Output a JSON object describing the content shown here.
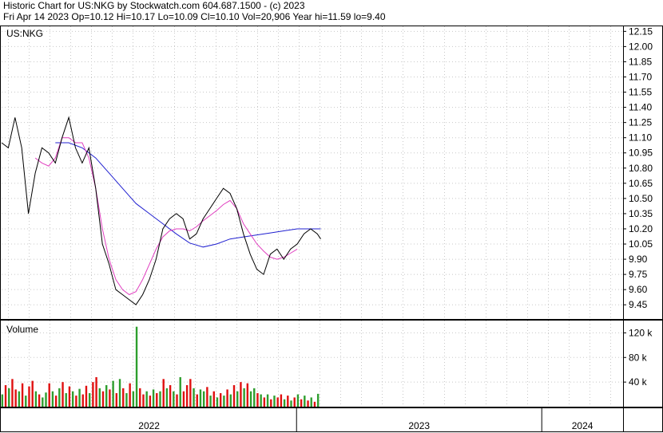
{
  "header": {
    "title": "Historic Chart for US:NKG by Stockwatch.com 604.687.1500 - (c) 2023",
    "quote": "Fri Apr 14 2023   Op=10.12  Hi=10.17  Lo=10.09  Cl=10.10  Vol=20,906  Year hi=11.59  lo=9.40"
  },
  "chart_data": {
    "type": "line",
    "symbol_label": "US:NKG",
    "volume_label": "Volume",
    "price_axis": {
      "ylim": [
        9.31,
        12.2
      ],
      "ticks": [
        "12.15",
        "12.00",
        "11.85",
        "11.70",
        "11.55",
        "11.40",
        "11.25",
        "11.10",
        "10.95",
        "10.80",
        "10.65",
        "10.50",
        "10.35",
        "10.20",
        "10.05",
        "9.90",
        "9.75",
        "9.60",
        "9.45"
      ]
    },
    "volume_axis": {
      "ylim": [
        0,
        140000
      ],
      "ticks": [
        {
          "label": "120 k",
          "value": 120000
        },
        {
          "label": "80 k",
          "value": 80000
        },
        {
          "label": "40 k",
          "value": 40000
        }
      ]
    },
    "x_axis": {
      "labels": [
        "2022",
        "2023",
        "2024"
      ],
      "year_boundaries": [
        "2023-01-01",
        "2024-01-01"
      ],
      "range": [
        "2021-10-19",
        "2024-05-01"
      ]
    },
    "colors": {
      "price": "#000000",
      "ma_short": "#e040c0",
      "ma_long": "#2020d0",
      "volume_up": "#2e9e2e",
      "volume_down": "#e01010"
    },
    "price_series": [
      [
        "2021-10-19",
        11.05
      ],
      [
        "2021-10-29",
        11.0
      ],
      [
        "2021-11-08",
        11.3
      ],
      [
        "2021-11-18",
        11.0
      ],
      [
        "2021-11-28",
        10.35
      ],
      [
        "2021-12-08",
        10.75
      ],
      [
        "2021-12-18",
        11.0
      ],
      [
        "2021-12-28",
        10.95
      ],
      [
        "2022-01-07",
        10.85
      ],
      [
        "2022-01-17",
        11.1
      ],
      [
        "2022-01-27",
        11.3
      ],
      [
        "2022-02-06",
        11.0
      ],
      [
        "2022-02-16",
        10.85
      ],
      [
        "2022-02-26",
        11.0
      ],
      [
        "2022-03-08",
        10.6
      ],
      [
        "2022-03-18",
        10.05
      ],
      [
        "2022-03-28",
        9.85
      ],
      [
        "2022-04-07",
        9.6
      ],
      [
        "2022-04-17",
        9.55
      ],
      [
        "2022-04-27",
        9.5
      ],
      [
        "2022-05-07",
        9.45
      ],
      [
        "2022-05-17",
        9.55
      ],
      [
        "2022-05-27",
        9.7
      ],
      [
        "2022-06-06",
        9.9
      ],
      [
        "2022-06-16",
        10.2
      ],
      [
        "2022-06-26",
        10.3
      ],
      [
        "2022-07-06",
        10.35
      ],
      [
        "2022-07-16",
        10.3
      ],
      [
        "2022-07-26",
        10.1
      ],
      [
        "2022-08-05",
        10.15
      ],
      [
        "2022-08-15",
        10.3
      ],
      [
        "2022-08-25",
        10.4
      ],
      [
        "2022-09-04",
        10.5
      ],
      [
        "2022-09-14",
        10.6
      ],
      [
        "2022-09-24",
        10.55
      ],
      [
        "2022-10-04",
        10.4
      ],
      [
        "2022-10-14",
        10.15
      ],
      [
        "2022-10-24",
        9.95
      ],
      [
        "2022-11-03",
        9.8
      ],
      [
        "2022-11-13",
        9.75
      ],
      [
        "2022-11-23",
        9.95
      ],
      [
        "2022-12-03",
        10.0
      ],
      [
        "2022-12-13",
        9.9
      ],
      [
        "2022-12-23",
        10.0
      ],
      [
        "2023-01-02",
        10.05
      ],
      [
        "2023-01-12",
        10.15
      ],
      [
        "2023-01-22",
        10.2
      ],
      [
        "2023-02-01",
        10.15
      ],
      [
        "2023-02-06",
        10.1
      ]
    ],
    "ma_short_series": [
      [
        "2021-12-08",
        10.9
      ],
      [
        "2021-12-18",
        10.85
      ],
      [
        "2021-12-28",
        10.82
      ],
      [
        "2022-01-07",
        10.9
      ],
      [
        "2022-01-17",
        11.1
      ],
      [
        "2022-01-27",
        11.1
      ],
      [
        "2022-02-06",
        11.05
      ],
      [
        "2022-02-16",
        11.05
      ],
      [
        "2022-02-26",
        10.9
      ],
      [
        "2022-03-08",
        10.6
      ],
      [
        "2022-03-18",
        10.2
      ],
      [
        "2022-03-28",
        9.9
      ],
      [
        "2022-04-07",
        9.7
      ],
      [
        "2022-04-17",
        9.6
      ],
      [
        "2022-04-27",
        9.55
      ],
      [
        "2022-05-07",
        9.58
      ],
      [
        "2022-05-17",
        9.7
      ],
      [
        "2022-05-27",
        9.85
      ],
      [
        "2022-06-06",
        10.0
      ],
      [
        "2022-06-16",
        10.12
      ],
      [
        "2022-06-26",
        10.18
      ],
      [
        "2022-07-06",
        10.2
      ],
      [
        "2022-07-16",
        10.2
      ],
      [
        "2022-07-26",
        10.18
      ],
      [
        "2022-08-05",
        10.22
      ],
      [
        "2022-08-15",
        10.28
      ],
      [
        "2022-08-25",
        10.33
      ],
      [
        "2022-09-04",
        10.38
      ],
      [
        "2022-09-14",
        10.44
      ],
      [
        "2022-09-24",
        10.48
      ],
      [
        "2022-10-04",
        10.4
      ],
      [
        "2022-10-14",
        10.25
      ],
      [
        "2022-10-24",
        10.15
      ],
      [
        "2022-11-03",
        10.05
      ],
      [
        "2022-11-13",
        9.98
      ],
      [
        "2022-11-23",
        9.92
      ],
      [
        "2022-12-03",
        9.9
      ],
      [
        "2022-12-13",
        9.92
      ],
      [
        "2022-12-23",
        9.96
      ],
      [
        "2023-01-02",
        10.0
      ]
    ],
    "ma_long_series": [
      [
        "2022-01-07",
        11.05
      ],
      [
        "2022-01-27",
        11.05
      ],
      [
        "2022-02-16",
        11.0
      ],
      [
        "2022-03-08",
        10.9
      ],
      [
        "2022-03-28",
        10.75
      ],
      [
        "2022-04-17",
        10.6
      ],
      [
        "2022-05-07",
        10.45
      ],
      [
        "2022-05-27",
        10.35
      ],
      [
        "2022-06-16",
        10.25
      ],
      [
        "2022-07-06",
        10.15
      ],
      [
        "2022-07-26",
        10.06
      ],
      [
        "2022-08-15",
        10.02
      ],
      [
        "2022-09-04",
        10.05
      ],
      [
        "2022-09-24",
        10.1
      ],
      [
        "2022-10-14",
        10.12
      ],
      [
        "2022-11-03",
        10.14
      ],
      [
        "2022-11-23",
        10.16
      ],
      [
        "2022-12-13",
        10.18
      ],
      [
        "2023-01-02",
        10.2
      ],
      [
        "2023-01-22",
        10.2
      ],
      [
        "2023-02-06",
        10.2
      ]
    ],
    "volume_series": [
      [
        "2021-10-20",
        20000,
        "up"
      ],
      [
        "2021-10-25",
        35000,
        "down"
      ],
      [
        "2021-10-30",
        30000,
        "up"
      ],
      [
        "2021-11-04",
        45000,
        "down"
      ],
      [
        "2021-11-09",
        28000,
        "down"
      ],
      [
        "2021-11-14",
        25000,
        "up"
      ],
      [
        "2021-11-19",
        38000,
        "down"
      ],
      [
        "2021-11-24",
        18000,
        "up"
      ],
      [
        "2021-11-29",
        33000,
        "down"
      ],
      [
        "2021-12-04",
        42000,
        "down"
      ],
      [
        "2021-12-09",
        25000,
        "up"
      ],
      [
        "2021-12-14",
        20000,
        "down"
      ],
      [
        "2021-12-19",
        15000,
        "up"
      ],
      [
        "2021-12-24",
        23000,
        "up"
      ],
      [
        "2021-12-29",
        38000,
        "down"
      ],
      [
        "2022-01-03",
        25000,
        "up"
      ],
      [
        "2022-01-08",
        18000,
        "down"
      ],
      [
        "2022-01-13",
        30000,
        "up"
      ],
      [
        "2022-01-18",
        40000,
        "down"
      ],
      [
        "2022-01-23",
        22000,
        "up"
      ],
      [
        "2022-01-28",
        33000,
        "down"
      ],
      [
        "2022-02-02",
        25000,
        "up"
      ],
      [
        "2022-02-07",
        18000,
        "down"
      ],
      [
        "2022-02-12",
        29000,
        "up"
      ],
      [
        "2022-02-17",
        20000,
        "down"
      ],
      [
        "2022-02-22",
        34000,
        "down"
      ],
      [
        "2022-02-27",
        22000,
        "up"
      ],
      [
        "2022-03-04",
        40000,
        "down"
      ],
      [
        "2022-03-09",
        48000,
        "down"
      ],
      [
        "2022-03-14",
        30000,
        "up"
      ],
      [
        "2022-03-19",
        25000,
        "down"
      ],
      [
        "2022-03-24",
        35000,
        "up"
      ],
      [
        "2022-03-29",
        28000,
        "down"
      ],
      [
        "2022-04-03",
        42000,
        "up"
      ],
      [
        "2022-04-08",
        22000,
        "down"
      ],
      [
        "2022-04-13",
        45000,
        "up"
      ],
      [
        "2022-04-18",
        30000,
        "down"
      ],
      [
        "2022-04-23",
        22000,
        "up"
      ],
      [
        "2022-04-28",
        38000,
        "down"
      ],
      [
        "2022-05-03",
        25000,
        "up"
      ],
      [
        "2022-05-08",
        130000,
        "up"
      ],
      [
        "2022-05-13",
        30000,
        "down"
      ],
      [
        "2022-05-18",
        20000,
        "down"
      ],
      [
        "2022-05-23",
        25000,
        "up"
      ],
      [
        "2022-05-28",
        18000,
        "down"
      ],
      [
        "2022-06-02",
        28000,
        "up"
      ],
      [
        "2022-06-07",
        22000,
        "down"
      ],
      [
        "2022-06-12",
        25000,
        "up"
      ],
      [
        "2022-06-17",
        45000,
        "down"
      ],
      [
        "2022-06-22",
        30000,
        "up"
      ],
      [
        "2022-06-27",
        35000,
        "down"
      ],
      [
        "2022-07-02",
        25000,
        "up"
      ],
      [
        "2022-07-07",
        20000,
        "down"
      ],
      [
        "2022-07-12",
        48000,
        "up"
      ],
      [
        "2022-07-17",
        25000,
        "down"
      ],
      [
        "2022-07-22",
        35000,
        "down"
      ],
      [
        "2022-07-27",
        45000,
        "down"
      ],
      [
        "2022-08-01",
        30000,
        "up"
      ],
      [
        "2022-08-06",
        20000,
        "down"
      ],
      [
        "2022-08-11",
        28000,
        "up"
      ],
      [
        "2022-08-16",
        25000,
        "up"
      ],
      [
        "2022-08-21",
        32000,
        "down"
      ],
      [
        "2022-08-26",
        18000,
        "up"
      ],
      [
        "2022-08-31",
        25000,
        "down"
      ],
      [
        "2022-09-05",
        15000,
        "up"
      ],
      [
        "2022-09-10",
        22000,
        "down"
      ],
      [
        "2022-09-15",
        18000,
        "up"
      ],
      [
        "2022-09-20",
        28000,
        "down"
      ],
      [
        "2022-09-25",
        20000,
        "up"
      ],
      [
        "2022-09-30",
        35000,
        "down"
      ],
      [
        "2022-10-05",
        25000,
        "up"
      ],
      [
        "2022-10-10",
        40000,
        "down"
      ],
      [
        "2022-10-15",
        30000,
        "up"
      ],
      [
        "2022-10-20",
        38000,
        "down"
      ],
      [
        "2022-10-25",
        25000,
        "up"
      ],
      [
        "2022-10-30",
        30000,
        "up"
      ],
      [
        "2022-11-04",
        22000,
        "down"
      ],
      [
        "2022-11-09",
        20000,
        "up"
      ],
      [
        "2022-11-14",
        15000,
        "down"
      ],
      [
        "2022-11-19",
        20000,
        "up"
      ],
      [
        "2022-11-24",
        12000,
        "down"
      ],
      [
        "2022-11-29",
        18000,
        "up"
      ],
      [
        "2022-12-04",
        15000,
        "down"
      ],
      [
        "2022-12-09",
        20000,
        "down"
      ],
      [
        "2022-12-14",
        12000,
        "up"
      ],
      [
        "2022-12-19",
        18000,
        "down"
      ],
      [
        "2022-12-24",
        10000,
        "up"
      ],
      [
        "2022-12-29",
        15000,
        "down"
      ],
      [
        "2023-01-03",
        20000,
        "up"
      ],
      [
        "2023-01-08",
        12000,
        "down"
      ],
      [
        "2023-01-13",
        18000,
        "up"
      ],
      [
        "2023-01-18",
        10000,
        "down"
      ],
      [
        "2023-01-23",
        15000,
        "up"
      ],
      [
        "2023-01-28",
        8000,
        "down"
      ],
      [
        "2023-02-02",
        20906,
        "up"
      ]
    ]
  }
}
